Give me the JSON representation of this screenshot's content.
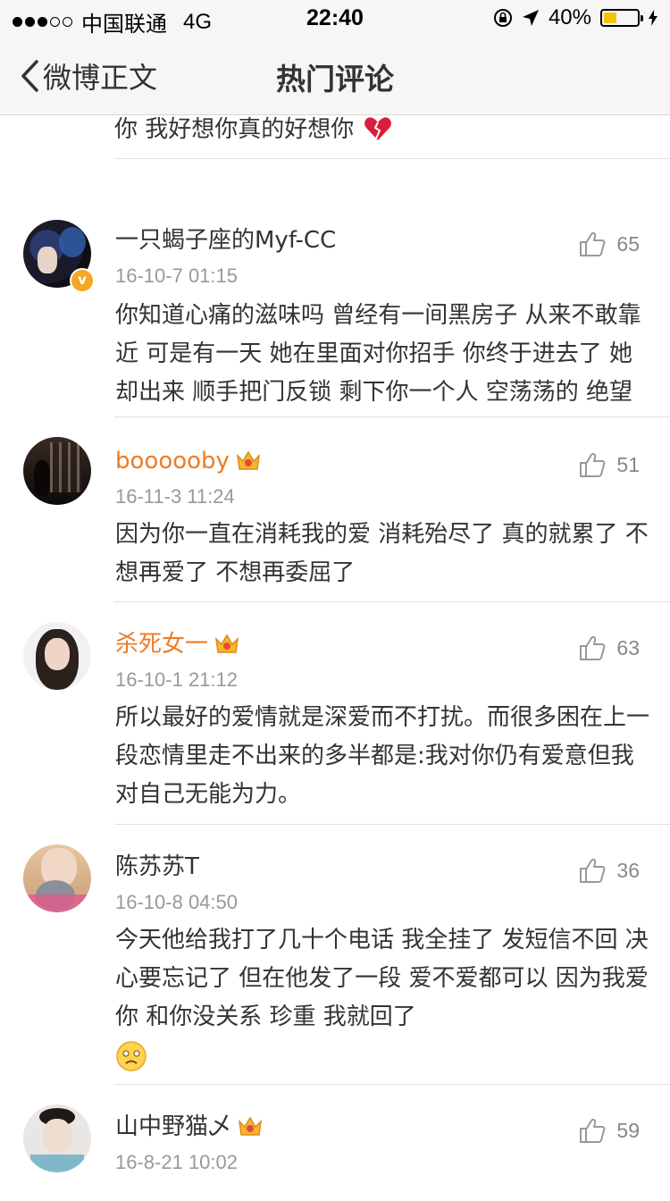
{
  "status": {
    "carrier": "中国联通",
    "network": "4G",
    "time": "22:40",
    "battery": "40%",
    "battery_level": 0.4
  },
  "nav": {
    "back_label": "微博正文",
    "title": "热门评论"
  },
  "partial_comment": {
    "text": "你 我好想你真的好想你",
    "emoji": "broken-heart-emoji"
  },
  "comments": [
    {
      "username": "一只蝎子座的Myf-CC",
      "time": "16-10-7 01:15",
      "likes": "65",
      "verified": true,
      "text": "你知道心痛的滋味吗  曾经有一间黑房子 从来不敢靠近  可是有一天 她在里面对你招手  你终于进去了 她却出来 顺手把门反锁  剩下你一个人 空荡荡的 绝望"
    },
    {
      "username": "boooooby",
      "time": "16-11-3 11:24",
      "likes": "51",
      "vip": true,
      "text": "因为你一直在消耗我的爱 消耗殆尽了 真的就累了 不想再爱了 不想再委屈了"
    },
    {
      "username": "杀死女一",
      "time": "16-10-1 21:12",
      "likes": "63",
      "vip": true,
      "text": "所以最好的爱情就是深爱而不打扰。而很多困在上一段恋情里走不出来的多半都是:我对你仍有爱意但我对自己无能为力。"
    },
    {
      "username": "陈苏苏T",
      "time": "16-10-8 04:50",
      "likes": "36",
      "text": "今天他给我打了几十个电话 我全挂了 发短信不回 决心要忘记了 但在他发了一段 爱不爱都可以 因为我爱你 和你没关系 珍重 我就回了",
      "emoji": "sad-face-emoji"
    },
    {
      "username": "山中野猫乄",
      "time": "16-8-21 10:02",
      "likes": "59",
      "vip": true,
      "text": ""
    }
  ],
  "colors": {
    "vip_name": "#ee7b25",
    "time": "#999999",
    "badge": "#f6a623"
  }
}
